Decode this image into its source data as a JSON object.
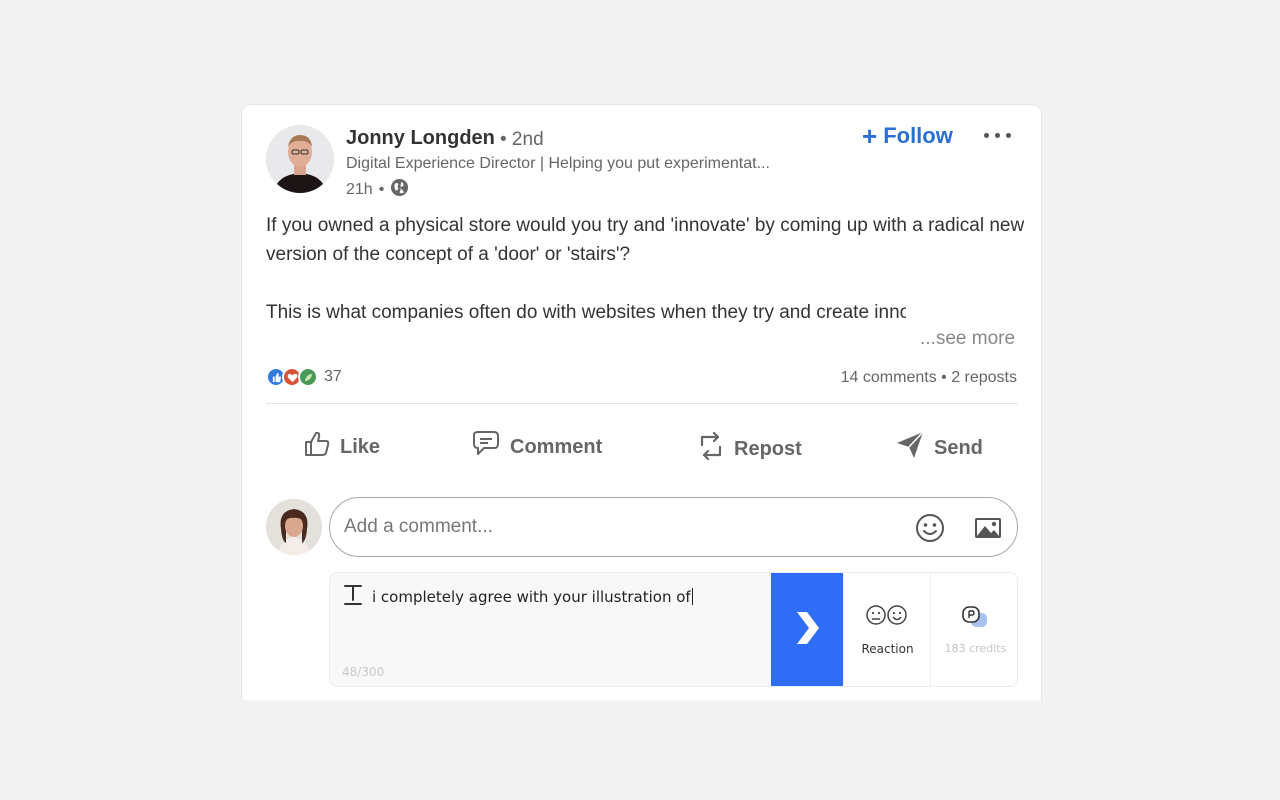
{
  "post": {
    "author": {
      "name": "Jonny Longden",
      "degree": "• 2nd",
      "headline": "Digital Experience Director | Helping you put experimentat...",
      "time": "21h",
      "dot": "•",
      "visibility_icon": "globe-icon"
    },
    "follow_label": "Follow",
    "more_icon": "ellipsis-icon",
    "text": {
      "paragraph1": "If you owned a physical store would you try and 'innovate' by coming up with a radical new version of the concept of a 'door' or 'stairs'?",
      "paragraph2": "This is what companies often do with websites when they try and create innovative and different UI around things like navigation or basic chec",
      "see_more": "...see more"
    },
    "reactions": {
      "icons": [
        "like-icon",
        "love-icon",
        "insightful-icon"
      ],
      "count": "37"
    },
    "engagement": "14 comments • 2 reposts"
  },
  "actions": {
    "like": "Like",
    "comment": "Comment",
    "repost": "Repost",
    "send": "Send"
  },
  "comment_box": {
    "placeholder": "Add a comment...",
    "emoji_icon": "emoji-icon",
    "image_icon": "image-icon"
  },
  "ai_panel": {
    "draft": "i completely agree with your illustration of",
    "char_count": "48/300",
    "reaction_label": "Reaction",
    "credits_label": "183 credits"
  },
  "colors": {
    "accent": "#2a6fd6",
    "submit": "#2f6df6",
    "background": "#f3f3f3"
  }
}
